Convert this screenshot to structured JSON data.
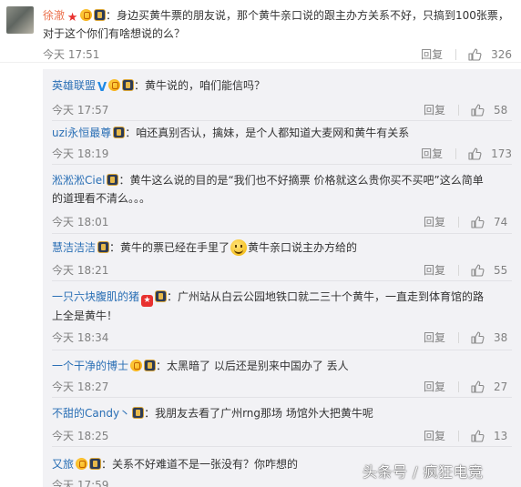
{
  "main_comment": {
    "username": "徐澈",
    "text": "：身边买黄牛票的朋友说，那个黄牛亲口说的跟主办方关系不好，只搞到100张票，对于这个你们有啥想说的么？",
    "time": "今天 17:51",
    "reply_label": "回复",
    "likes": "326"
  },
  "replies": [
    {
      "username": "英雄联盟",
      "blue": true,
      "text": "：黄牛说的，咱们能信吗？",
      "time": "今天 17:57",
      "reply_label": "回复",
      "likes": "58"
    },
    {
      "username": "uzi永恒最尊",
      "blue": true,
      "text": "：咱还真别否认，擒妹，是个人都知道大麦网和黄牛有关系",
      "time": "今天 18:19",
      "reply_label": "回复",
      "likes": "173"
    },
    {
      "username": "淞淞淞Ciel",
      "blue": true,
      "text": "：黄牛这么说的目的是“我们也不好摘票 价格就这么贵你买不买吧”这么简单的道理看不清么。。。",
      "time": "今天 18:01",
      "reply_label": "回复",
      "likes": "74"
    },
    {
      "username": "慧洁洁洁",
      "blue": true,
      "text_before": "：黄牛的票已经在手里了",
      "text_after": "黄牛亲口说主办方给的",
      "time": "今天 18:21",
      "reply_label": "回复",
      "likes": "55"
    },
    {
      "username": "一只六块腹肌的猪",
      "blue": true,
      "text": "：广州站从白云公园地铁口就二三十个黄牛，一直走到体育馆的路上全是黄牛！",
      "time": "今天 18:34",
      "reply_label": "回复",
      "likes": "38"
    },
    {
      "username": "一个干净的博士",
      "blue": true,
      "text": "：太黑暗了 以后还是别来中国办了 丢人",
      "time": "今天 18:27",
      "reply_label": "回复",
      "likes": "27"
    },
    {
      "username": "不甜的Candy丶",
      "blue": true,
      "text": "：我朋友去看了广州rng那场 场馆外大把黄牛呢",
      "time": "今天 18:25",
      "reply_label": "回复",
      "likes": "13"
    },
    {
      "username": "又旅",
      "blue": true,
      "text": "：关系不好难道不是一张没有？你咋想的",
      "time": "今天 17:59",
      "reply_label": "",
      "likes": ""
    }
  ],
  "watermark": "头条号 / 疯狂电竞",
  "colors": {
    "reply_bg": "#f2f2f5",
    "username_blue": "#2a6fb5",
    "username_orange": "#eb7350",
    "meta": "#808080"
  },
  "icons": {
    "like": "thumb-up-icon",
    "vip": "crown-badge-icon",
    "verified": "verified-v-icon",
    "game": "game-badge-icon",
    "emoji": "smiley-emoji"
  }
}
